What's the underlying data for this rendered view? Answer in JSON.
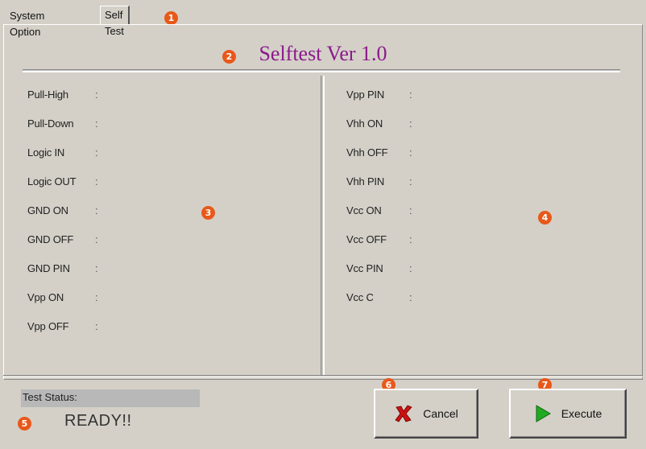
{
  "tabs": [
    {
      "label": "System Option"
    },
    {
      "label": "Self Test"
    }
  ],
  "title": "Selftest Ver 1.0",
  "left_rows": [
    {
      "label": "Pull-High",
      "sep": ":"
    },
    {
      "label": "Pull-Down",
      "sep": ":"
    },
    {
      "label": "Logic IN",
      "sep": ":"
    },
    {
      "label": "Logic OUT",
      "sep": ":"
    },
    {
      "label": "GND ON",
      "sep": ":"
    },
    {
      "label": "GND OFF",
      "sep": ":"
    },
    {
      "label": "GND PIN",
      "sep": ":"
    },
    {
      "label": "Vpp ON",
      "sep": ":"
    },
    {
      "label": "Vpp OFF",
      "sep": ":"
    }
  ],
  "right_rows": [
    {
      "label": "Vpp PIN",
      "sep": ":"
    },
    {
      "label": "Vhh ON",
      "sep": ":"
    },
    {
      "label": "Vhh OFF",
      "sep": ":"
    },
    {
      "label": "Vhh PIN",
      "sep": ":"
    },
    {
      "label": "Vcc ON",
      "sep": ":"
    },
    {
      "label": "Vcc OFF",
      "sep": ":"
    },
    {
      "label": "Vcc PIN",
      "sep": ":"
    },
    {
      "label": "Vcc C",
      "sep": ":"
    }
  ],
  "status": {
    "label": "Test  Status:",
    "value": "READY!!"
  },
  "buttons": {
    "cancel": "Cancel",
    "execute": "Execute",
    "cancel_icon": "x-icon",
    "execute_icon": "play-icon"
  },
  "callouts": [
    "1",
    "2",
    "3",
    "4",
    "5",
    "6",
    "7"
  ],
  "colors": {
    "title": "#8b1a8b",
    "callout": "#e8581a",
    "cancel_icon": "#cc1111",
    "execute_icon": "#22aa22"
  }
}
